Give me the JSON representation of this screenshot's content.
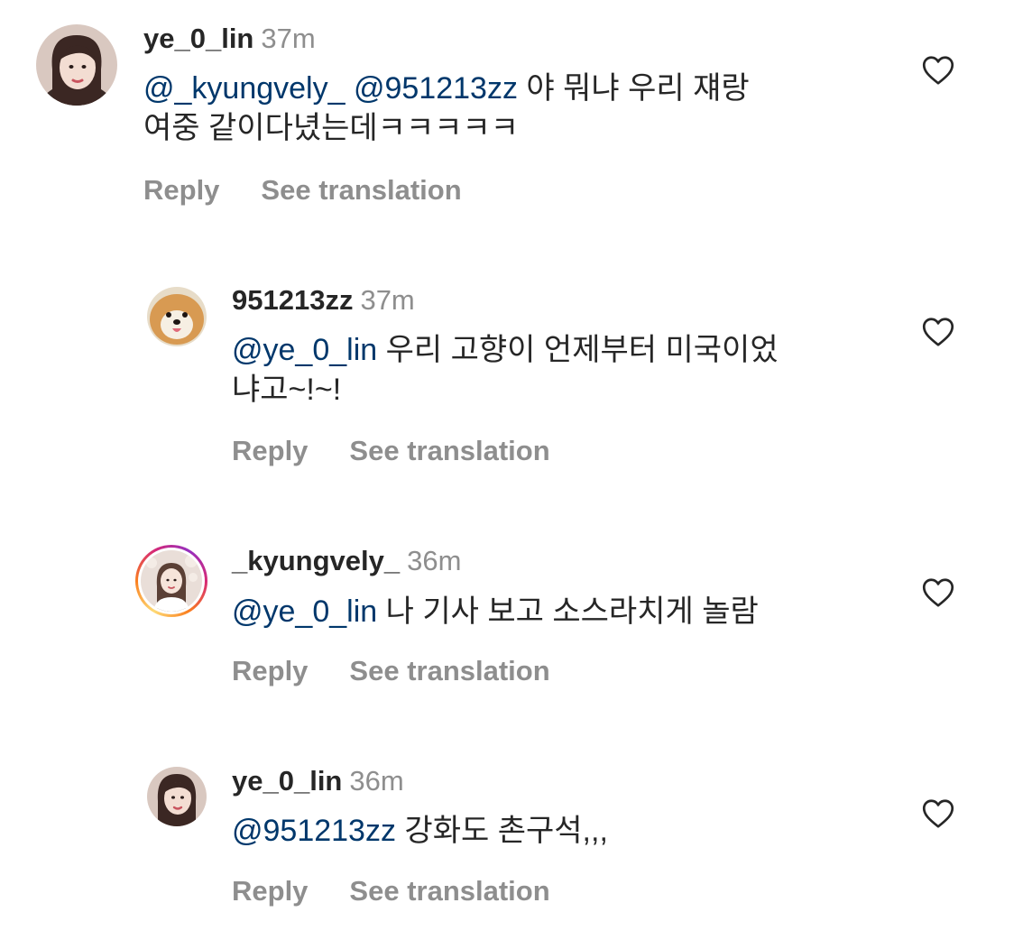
{
  "comments": [
    {
      "username": "ye_0_lin",
      "time": "37m",
      "mentions": "@_kyungvely_ @951213zz",
      "text_line1": " 야 뭐냐 우리 쟤랑",
      "text_line2": "여중 같이다녔는데ㅋㅋㅋㅋㅋ",
      "reply_label": "Reply",
      "translate_label": "See translation",
      "like_icon": "heart-icon"
    },
    {
      "username": "951213zz",
      "time": "37m",
      "mentions": "@ye_0_lin",
      "text_line1": " 우리 고향이 언제부터 미국이었",
      "text_line2": "냐고~!~!",
      "reply_label": "Reply",
      "translate_label": "See translation",
      "like_icon": "heart-icon"
    },
    {
      "username": "_kyungvely_",
      "time": "36m",
      "mentions": "@ye_0_lin",
      "text_line1": " 나 기사 보고 소스라치게 놀람",
      "reply_label": "Reply",
      "translate_label": "See translation",
      "like_icon": "heart-icon",
      "has_story_ring": true
    },
    {
      "username": "ye_0_lin",
      "time": "36m",
      "mentions": "@951213zz",
      "text_line1": " 강화도 촌구석,,,",
      "reply_label": "Reply",
      "translate_label": "See translation",
      "like_icon": "heart-icon"
    }
  ],
  "colors": {
    "text": "#262626",
    "secondary": "#8e8e8e",
    "mention": "#00376b"
  }
}
